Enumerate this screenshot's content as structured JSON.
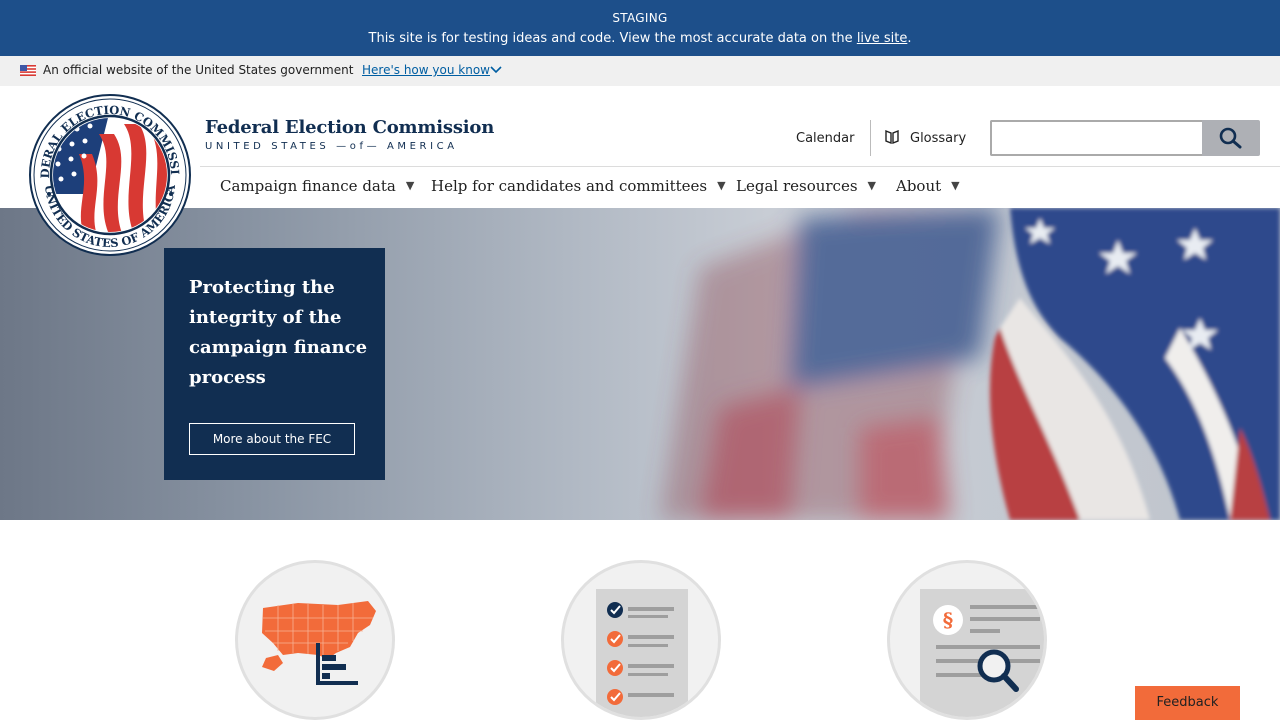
{
  "staging": {
    "label": "STAGING",
    "message": "This site is for testing ideas and code. View the most accurate data on the",
    "link": "live site",
    "period": "."
  },
  "gov_banner": {
    "text": "An official website of the United States government",
    "link": "Here's how you know"
  },
  "brand": {
    "title": "Federal Election Commission",
    "subtitle": "UNITED STATES —of— AMERICA"
  },
  "utility": {
    "calendar": "Calendar",
    "glossary": "Glossary",
    "search_value": ""
  },
  "nav": {
    "items": [
      {
        "label": "Campaign finance data"
      },
      {
        "label": "Help for candidates and committees"
      },
      {
        "label": "Legal resources"
      },
      {
        "label": "About"
      }
    ]
  },
  "hero": {
    "heading": "Protecting the integrity of the campaign finance process",
    "button": "More about the FEC"
  },
  "features": [
    {
      "icon": "us-map-chart-icon"
    },
    {
      "icon": "checklist-icon"
    },
    {
      "icon": "legal-search-icon"
    }
  ],
  "feedback": "Feedback",
  "colors": {
    "staging_bg": "#1d4f8a",
    "navy": "#112e51",
    "orange": "#f26b3a"
  }
}
